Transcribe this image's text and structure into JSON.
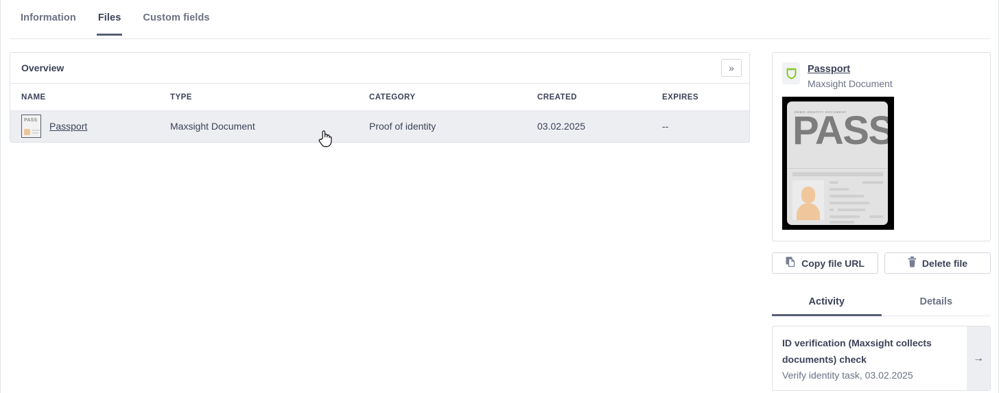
{
  "tabs": [
    {
      "label": "Information",
      "active": false
    },
    {
      "label": "Files",
      "active": true
    },
    {
      "label": "Custom fields",
      "active": false
    }
  ],
  "overview": {
    "title": "Overview",
    "expand_label": "»",
    "columns": [
      "NAME",
      "TYPE",
      "CATEGORY",
      "CREATED",
      "EXPIRES"
    ],
    "rows": [
      {
        "name": "Passport",
        "type": "Maxsight Document",
        "category": "Proof of identity",
        "created": "03.02.2025",
        "expires": "--",
        "thumb_label": "PASS"
      }
    ]
  },
  "preview": {
    "title": "Passport",
    "subtitle": "Maxsight Document",
    "shield_color": "#7ac70c",
    "document": {
      "header_text": "DEMO IDENTITY DOCUMENT",
      "big_text": "PASS"
    }
  },
  "actions": {
    "copy_label": "Copy file URL",
    "delete_label": "Delete file"
  },
  "side_tabs": [
    {
      "label": "Activity",
      "active": true
    },
    {
      "label": "Details",
      "active": false
    }
  ],
  "activity": [
    {
      "title": "ID verification (Maxsight collects documents) check",
      "subtitle": "Verify identity task, 03.02.2025",
      "arrow": "→"
    }
  ],
  "colors": {
    "text_dark": "#3c4257",
    "text_muted": "#6b7183",
    "border": "#dfe0e6",
    "row_hover": "#eceef1",
    "tab_underline": "#575e75"
  }
}
